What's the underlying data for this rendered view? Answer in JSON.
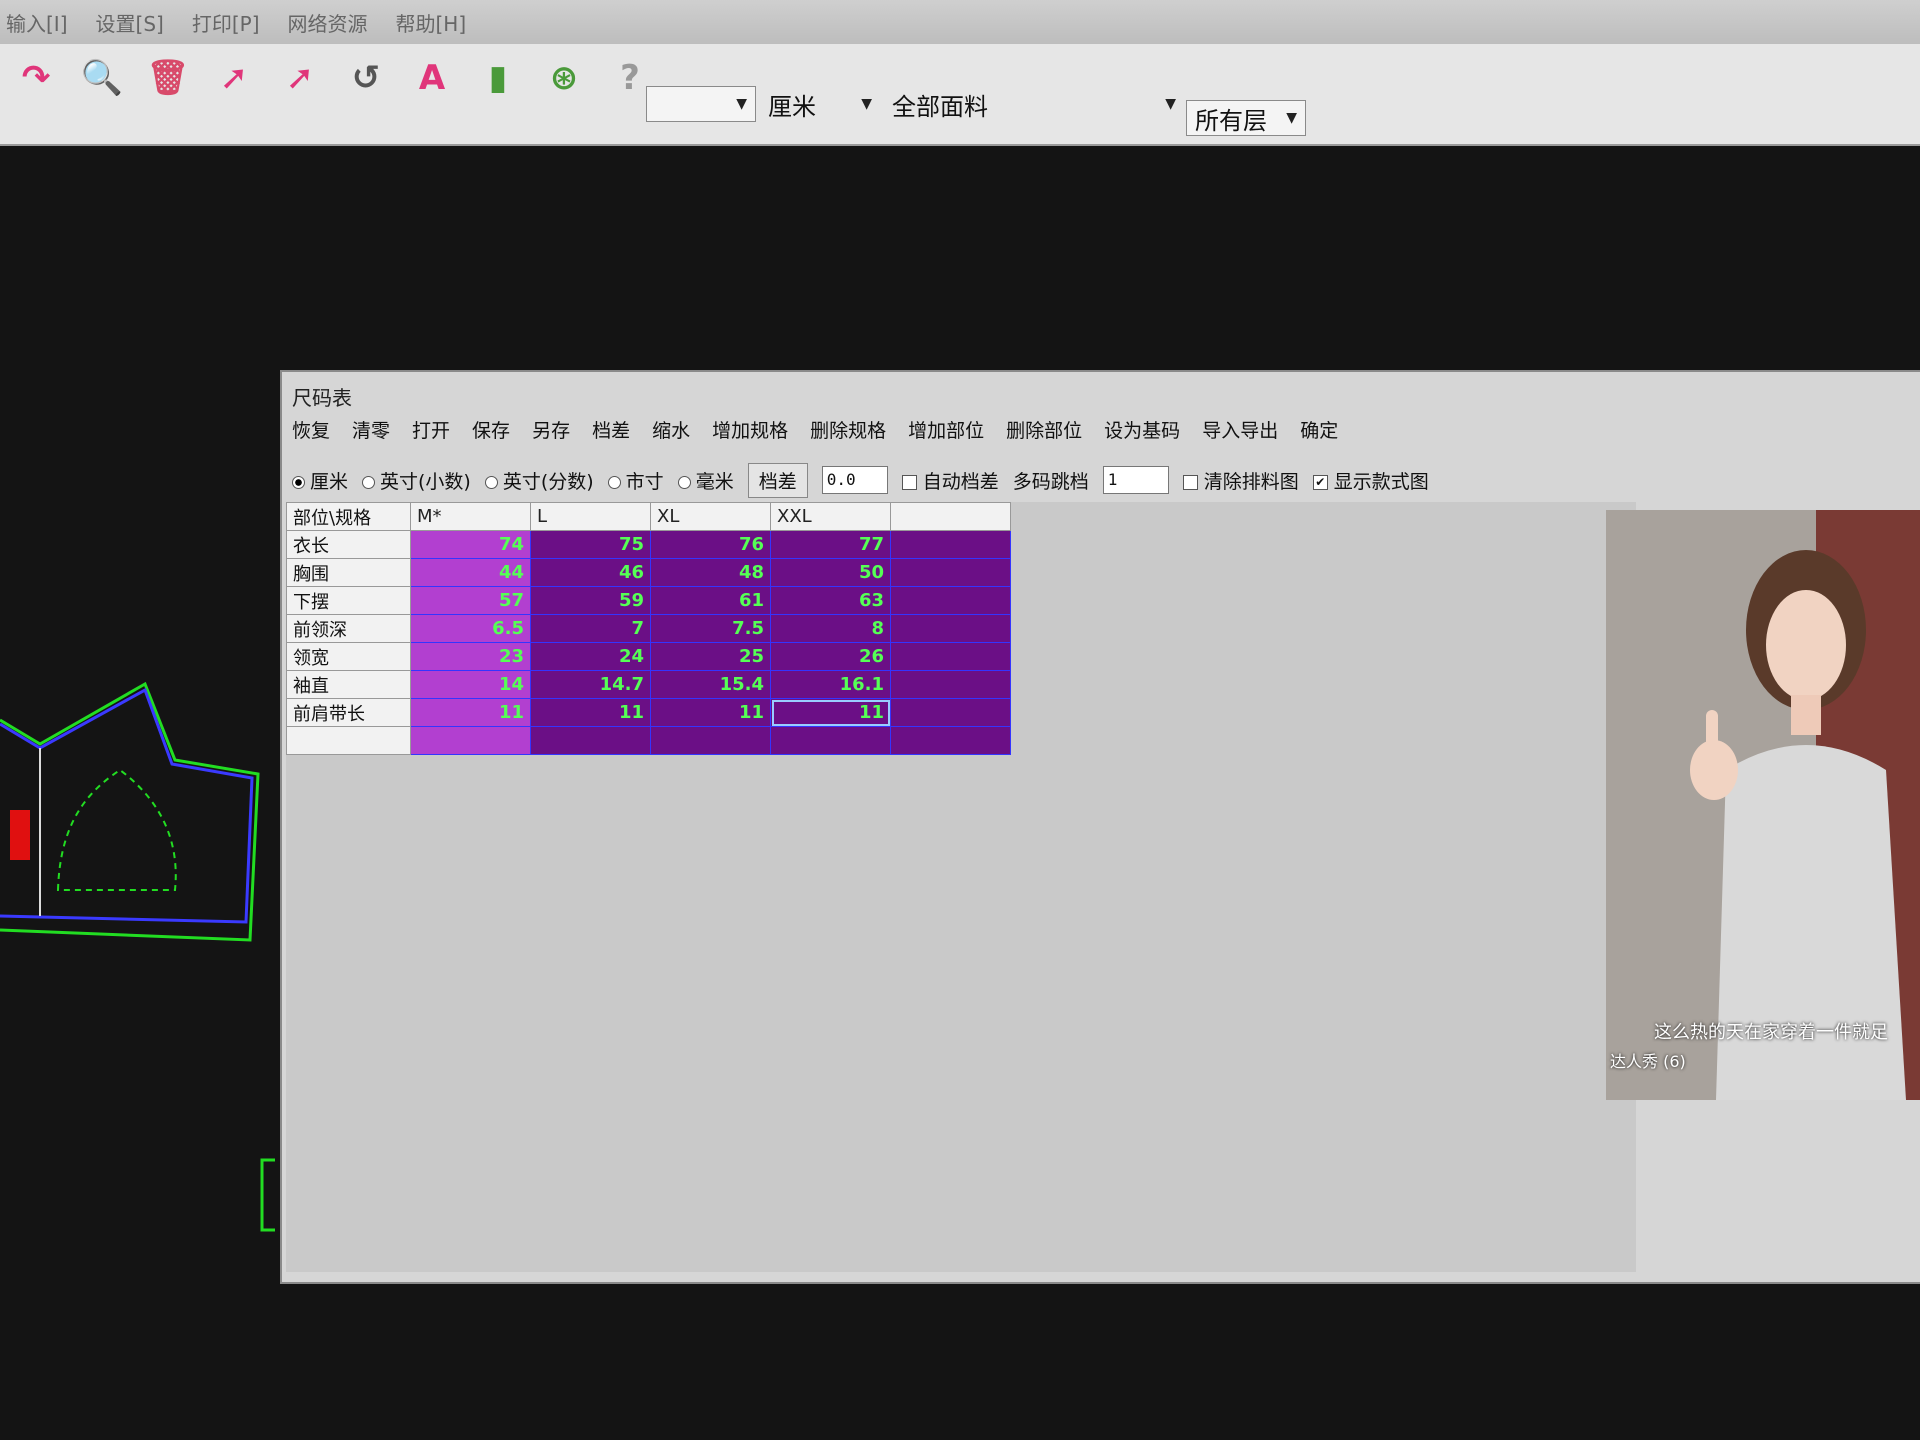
{
  "app": {
    "menu": [
      "输入[I]",
      "设置[S]",
      "打印[P]",
      "网络资源",
      "帮助[H]"
    ],
    "toolbar": {
      "unit_select": "厘米",
      "fabric_select": "全部面料",
      "layer_select": "所有层"
    }
  },
  "dialog": {
    "title": "尺码表",
    "menu": [
      "恢复",
      "清零",
      "打开",
      "保存",
      "另存",
      "档差",
      "缩水",
      "增加规格",
      "删除规格",
      "增加部位",
      "删除部位",
      "设为基码",
      "导入导出",
      "确定"
    ],
    "units": [
      {
        "label": "厘米",
        "selected": true
      },
      {
        "label": "英寸(小数)",
        "selected": false
      },
      {
        "label": "英寸(分数)",
        "selected": false
      },
      {
        "label": "市寸",
        "selected": false
      },
      {
        "label": "毫米",
        "selected": false
      }
    ],
    "grade_button": "档差",
    "grade_value": "0.0",
    "auto_grade_label": "自动档差",
    "multi_jump_label": "多码跳档",
    "multi_jump_value": "1",
    "clear_marker_label": "清除排料图",
    "show_style_label": "显示款式图",
    "table": {
      "corner": "部位\\规格",
      "sizes": [
        "M*",
        "L",
        "XL",
        "XXL"
      ],
      "rows": [
        {
          "part": "衣长",
          "values": [
            "74",
            "75",
            "76",
            "77"
          ]
        },
        {
          "part": "胸围",
          "values": [
            "44",
            "46",
            "48",
            "50"
          ]
        },
        {
          "part": "下摆",
          "values": [
            "57",
            "59",
            "61",
            "63"
          ]
        },
        {
          "part": "前领深",
          "values": [
            "6.5",
            "7",
            "7.5",
            "8"
          ]
        },
        {
          "part": "领宽",
          "values": [
            "23",
            "24",
            "25",
            "26"
          ]
        },
        {
          "part": "袖直",
          "values": [
            "14",
            "14.7",
            "15.4",
            "16.1"
          ]
        },
        {
          "part": "前肩带长",
          "values": [
            "11",
            "11",
            "11",
            "11"
          ]
        }
      ]
    }
  },
  "video": {
    "caption": "这么热的天在家穿着一件就足",
    "author": "达人秀 (6)"
  }
}
